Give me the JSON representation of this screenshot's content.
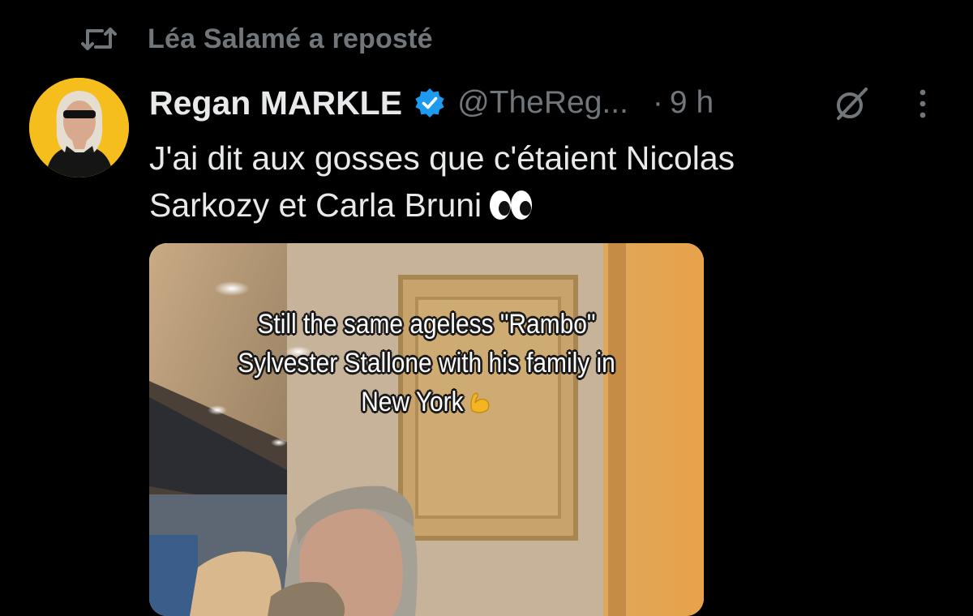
{
  "repost": {
    "label": "Léa Salamé a reposté",
    "icon": "repost-icon"
  },
  "tweet": {
    "author": {
      "display_name": "Regan MARKLE",
      "handle": "@TheReg...",
      "verified": true,
      "avatar_bg": "#f6be1d"
    },
    "separator": "·",
    "time": "9 h",
    "text_line1": "J'ai dit aux gosses que c'étaient Nicolas",
    "text_line2": "Sarkozy et Carla Bruni",
    "text_emoji": "eyes-emoji",
    "media": {
      "caption_line1": "Still the same ageless \"Rambo\"",
      "caption_line2": "Sylvester Stallone with his family in",
      "caption_line3": "New York",
      "caption_emoji": "flexed-biceps-emoji"
    }
  },
  "icons": {
    "grok": "grok-icon",
    "more": "more-options-icon",
    "verified": "verified-badge-icon"
  },
  "colors": {
    "background": "#000000",
    "primary_text": "#e7e9ea",
    "secondary_text": "#71767b",
    "verified_blue": "#1d9bf0"
  }
}
